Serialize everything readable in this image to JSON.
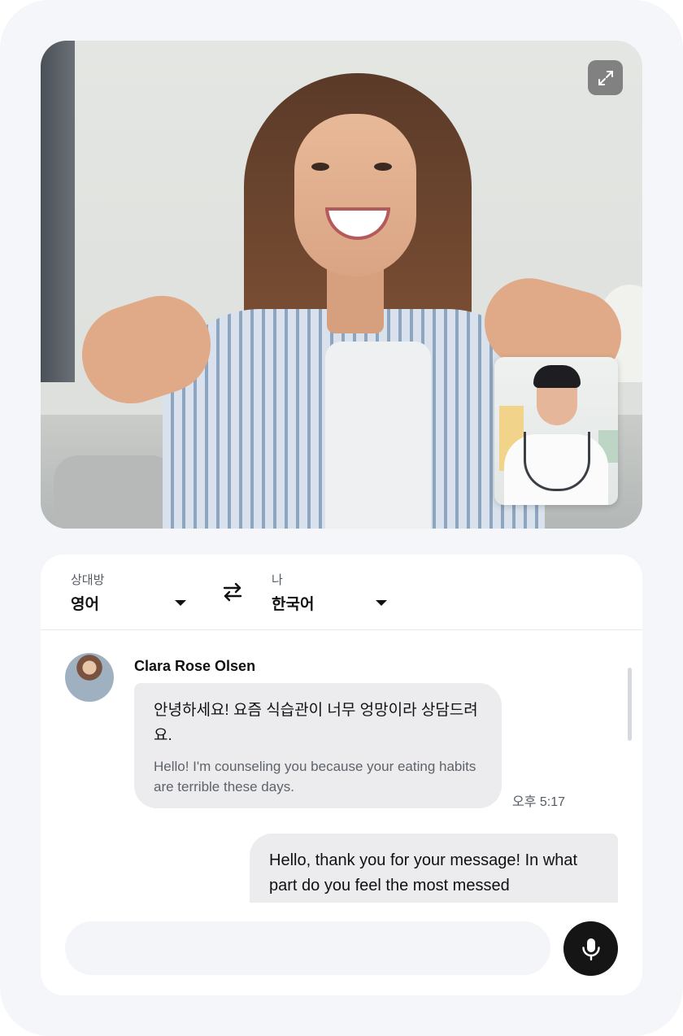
{
  "video": {
    "remote_participant": "Clara Rose Olsen",
    "expand_icon": "expand-icon"
  },
  "language_bar": {
    "partner": {
      "caption": "상대방",
      "value": "영어"
    },
    "me": {
      "caption": "나",
      "value": "한국어"
    },
    "swap_icon": "swap-arrows-icon"
  },
  "messages": [
    {
      "sender": "Clara Rose Olsen",
      "text": "안녕하세요! 요즘 식습관이 너무 엉망이라 상담드려요.",
      "translation": "Hello! I'm counseling you because your eating habits are terrible these days.",
      "time": "오후 5:17"
    },
    {
      "sender": "me",
      "text": "Hello, thank you for your message! In what part do you feel the most messed"
    }
  ],
  "composer": {
    "placeholder": "",
    "mic_icon": "microphone-icon"
  },
  "colors": {
    "page_bg": "#f4f6f9",
    "bubble_bg": "#ececee",
    "mic_button": "#151515"
  }
}
